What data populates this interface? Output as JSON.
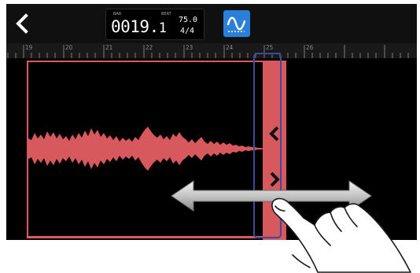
{
  "header": {
    "back_icon": "chevron-left-icon",
    "counter": {
      "bar_label": "BAR",
      "beat_label": "BEAT",
      "value_main": "0019.",
      "value_sub": "1",
      "tempo": "75.0",
      "time_signature": "4/4"
    },
    "waveform_button_icon": "waveform-icon",
    "accent_color": "#2b7fd6"
  },
  "ruler": {
    "markers": [
      "19",
      "20",
      "21",
      "22",
      "23",
      "24",
      "25",
      "26"
    ]
  },
  "region": {
    "color": "#d7595e",
    "handle_icons": [
      "chevron-left-icon",
      "chevron-right-icon"
    ]
  },
  "gesture": {
    "arrow_icon": "double-arrow-horizontal-icon",
    "hand_icon": "finger-tap-icon"
  }
}
